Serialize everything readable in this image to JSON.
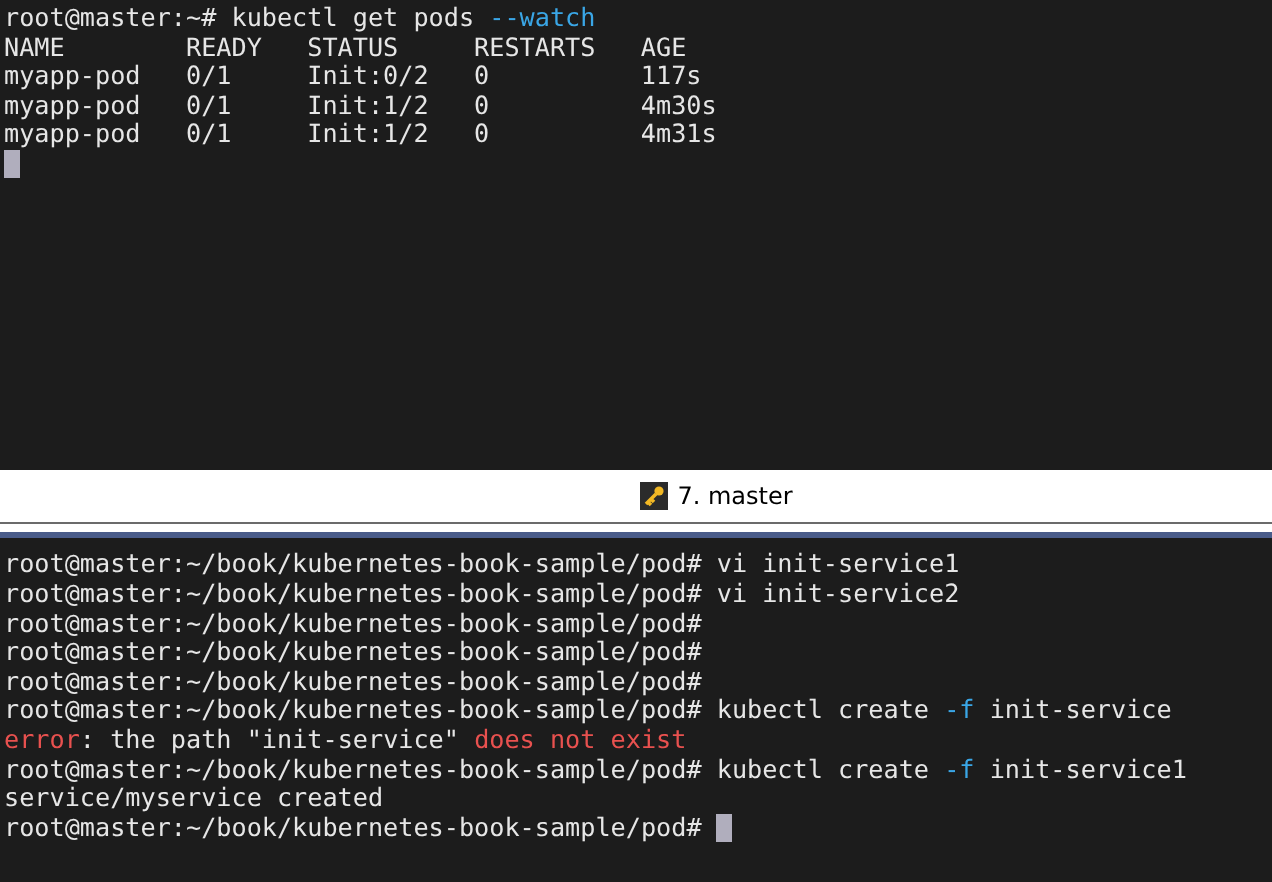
{
  "top_pane": {
    "command_line": [
      {
        "kind": "plain",
        "text": "root@master:~# kubectl get pods "
      },
      {
        "kind": "flag",
        "text": "--watch"
      }
    ],
    "table": {
      "columns": [
        "NAME",
        "READY",
        "STATUS",
        "RESTARTS",
        "AGE"
      ],
      "rows": [
        [
          "myapp-pod",
          "0/1",
          "Init:0/2",
          "0",
          "117s"
        ],
        [
          "myapp-pod",
          "0/1",
          "Init:1/2",
          "0",
          "4m30s"
        ],
        [
          "myapp-pod",
          "0/1",
          "Init:1/2",
          "0",
          "4m31s"
        ]
      ]
    },
    "cursor": true
  },
  "tab_bar": {
    "tabs": [
      {
        "label": "7. master",
        "selected": true
      }
    ]
  },
  "bottom_pane": {
    "lines": [
      [
        {
          "kind": "plain",
          "text": "root@master:~/book/kubernetes-book-sample/pod# vi init-service1"
        }
      ],
      [
        {
          "kind": "plain",
          "text": "root@master:~/book/kubernetes-book-sample/pod# vi init-service2"
        }
      ],
      [
        {
          "kind": "plain",
          "text": "root@master:~/book/kubernetes-book-sample/pod#"
        }
      ],
      [
        {
          "kind": "plain",
          "text": "root@master:~/book/kubernetes-book-sample/pod#"
        }
      ],
      [
        {
          "kind": "plain",
          "text": "root@master:~/book/kubernetes-book-sample/pod#"
        }
      ],
      [
        {
          "kind": "plain",
          "text": "root@master:~/book/kubernetes-book-sample/pod# kubectl create "
        },
        {
          "kind": "flag",
          "text": "-f"
        },
        {
          "kind": "plain",
          "text": " init-service"
        }
      ],
      [
        {
          "kind": "error",
          "text": "error"
        },
        {
          "kind": "plain",
          "text": ": the path \"init-service\" "
        },
        {
          "kind": "error",
          "text": "does not exist"
        }
      ],
      [
        {
          "kind": "plain",
          "text": "root@master:~/book/kubernetes-book-sample/pod# kubectl create "
        },
        {
          "kind": "flag",
          "text": "-f"
        },
        {
          "kind": "plain",
          "text": " init-service1"
        }
      ],
      [
        {
          "kind": "plain",
          "text": "service/myservice created"
        }
      ],
      [
        {
          "kind": "plain",
          "text": "root@master:~/book/kubernetes-book-sample/pod# "
        }
      ]
    ],
    "cursor": true
  }
}
